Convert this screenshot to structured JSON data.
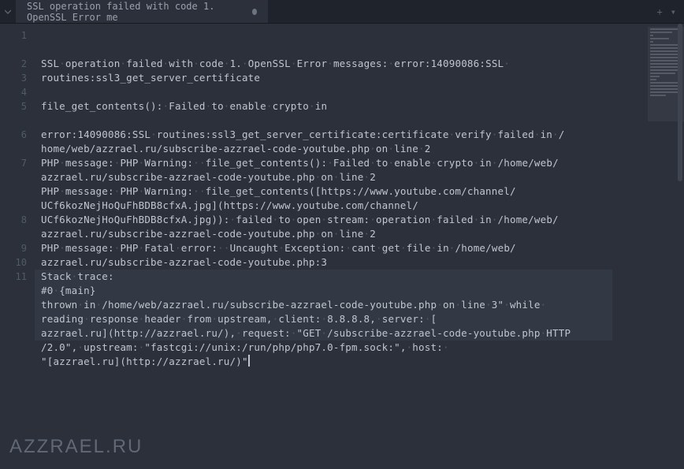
{
  "tab": {
    "title": "SSL operation failed with code 1. OpenSSL Error me",
    "modified": true
  },
  "whitespace_dot": "·",
  "lines": [
    {
      "n": 1,
      "wrapped": [
        "SSL operation failed with code 1. OpenSSL Error messages: error:14090086:SSL ",
        "routines:ssl3_get_server_certificate"
      ]
    },
    {
      "n": 2,
      "wrapped": [
        ""
      ]
    },
    {
      "n": 3,
      "wrapped": [
        "file_get_contents(): Failed to enable crypto in"
      ]
    },
    {
      "n": 4,
      "wrapped": [
        ""
      ]
    },
    {
      "n": 5,
      "wrapped": [
        "error:14090086:SSL routines:ssl3_get_server_certificate:certificate verify failed in /",
        "home/web/azzrael.ru/subscribe-azzrael-code-youtube.php on line 2"
      ]
    },
    {
      "n": 6,
      "wrapped": [
        "PHP message: PHP Warning:  file_get_contents(): Failed to enable crypto in /home/web/",
        "azzrael.ru/subscribe-azzrael-code-youtube.php on line 2"
      ]
    },
    {
      "n": 7,
      "wrapped": [
        "PHP message: PHP Warning:  file_get_contents([https://www.youtube.com/channel/",
        "UCf6kozNejHoQuFhBDB8cfxA.jpg](https://www.youtube.com/channel/",
        "UCf6kozNejHoQuFhBDB8cfxA.jpg)): failed to open stream: operation failed in /home/web/",
        "azzrael.ru/subscribe-azzrael-code-youtube.php on line 2"
      ]
    },
    {
      "n": 8,
      "wrapped": [
        "PHP message: PHP Fatal error:  Uncaught Exception: cant get file in /home/web/",
        "azzrael.ru/subscribe-azzrael-code-youtube.php:3"
      ]
    },
    {
      "n": 9,
      "wrapped": [
        "Stack trace:"
      ]
    },
    {
      "n": 10,
      "wrapped": [
        "#0 {main}"
      ]
    },
    {
      "n": 11,
      "current": true,
      "wrapped": [
        "thrown in /home/web/azzrael.ru/subscribe-azzrael-code-youtube.php on line 3\" while ",
        "reading response header from upstream, client: 8.8.8.8, server: [",
        "azzrael.ru](http://azzrael.ru/), request: \"GET /subscribe-azzrael-code-youtube.php HTTP",
        "/2.0\", upstream: \"fastcgi://unix:/run/php/php7.0-fpm.sock:\", host: ",
        "\"[azzrael.ru](http://azzrael.ru/)\""
      ]
    }
  ],
  "watermark": "AZZRAEL.RU",
  "tab_actions": {
    "new": "+",
    "menu": "▾"
  }
}
